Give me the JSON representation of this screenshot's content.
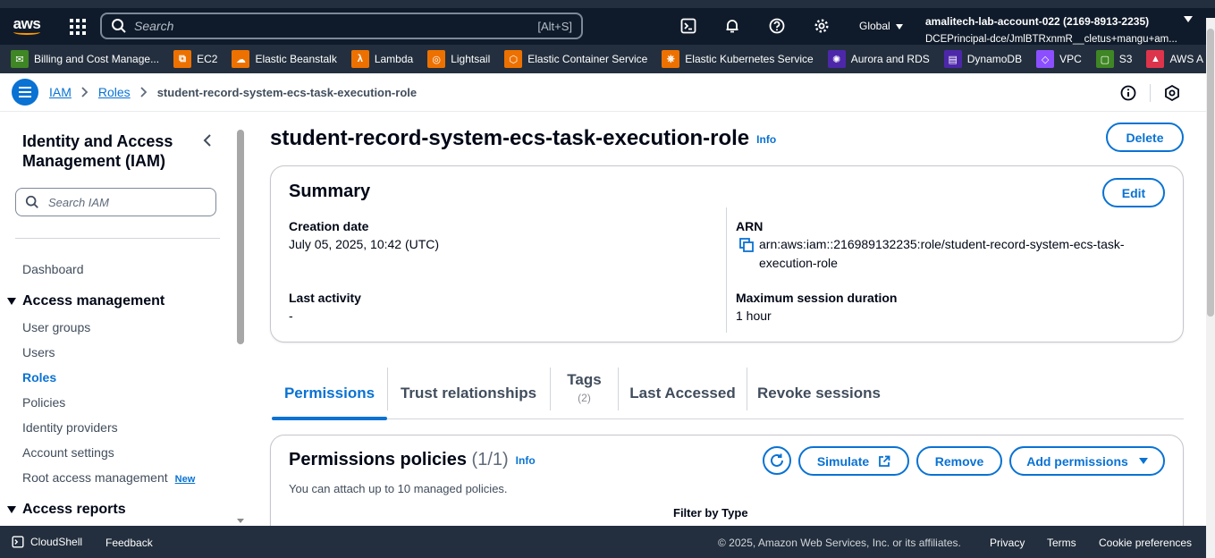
{
  "topnav": {
    "logo": "aws",
    "search_placeholder": "Search",
    "search_shortcut": "[Alt+S]",
    "region": "Global",
    "account_name": "amalitech-lab-account-022 (2169-8913-2235)",
    "account_principal": "DCEPrincipal-dce/JmlBTRxnmR__cletus+mangu+am..."
  },
  "favorites": [
    {
      "label": "Billing and Cost Manage...",
      "color": "#3f8624",
      "glyph": "✉"
    },
    {
      "label": "EC2",
      "color": "#ed7100",
      "glyph": "⧉"
    },
    {
      "label": "Elastic Beanstalk",
      "color": "#ed7100",
      "glyph": "☁"
    },
    {
      "label": "Lambda",
      "color": "#ed7100",
      "glyph": "λ"
    },
    {
      "label": "Lightsail",
      "color": "#ed7100",
      "glyph": "◎"
    },
    {
      "label": "Elastic Container Service",
      "color": "#ed7100",
      "glyph": "⬡"
    },
    {
      "label": "Elastic Kubernetes Service",
      "color": "#ed7100",
      "glyph": "⎈"
    },
    {
      "label": "Aurora and RDS",
      "color": "#4d27aa",
      "glyph": "✺"
    },
    {
      "label": "DynamoDB",
      "color": "#4d27aa",
      "glyph": "▤"
    },
    {
      "label": "VPC",
      "color": "#8c4fff",
      "glyph": "◇"
    },
    {
      "label": "S3",
      "color": "#3f8624",
      "glyph": "▢"
    },
    {
      "label": "AWS A",
      "color": "#dd344c",
      "glyph": "▲"
    }
  ],
  "breadcrumb": {
    "iam": "IAM",
    "roles": "Roles",
    "current": "student-record-system-ecs-task-execution-role"
  },
  "sidebar": {
    "title": "Identity and Access Management (IAM)",
    "search_placeholder": "Search IAM",
    "dashboard": "Dashboard",
    "access_management": "Access management",
    "items": [
      "User groups",
      "Users",
      "Roles",
      "Policies",
      "Identity providers",
      "Account settings",
      "Root access management"
    ],
    "new_badge": "New",
    "access_reports": "Access reports"
  },
  "main": {
    "title": "student-record-system-ecs-task-execution-role",
    "info": "Info",
    "delete": "Delete",
    "summary": {
      "title": "Summary",
      "edit": "Edit",
      "creation_date_label": "Creation date",
      "creation_date": "July 05, 2025, 10:42 (UTC)",
      "arn_label": "ARN",
      "arn_line1": "arn:aws:iam::216989132235:role/student-record-system-ecs-task-",
      "arn_line2": "execution-role",
      "last_activity_label": "Last activity",
      "last_activity": "-",
      "max_session_label": "Maximum session duration",
      "max_session": "1 hour"
    },
    "tabs": {
      "permissions": "Permissions",
      "trust": "Trust relationships",
      "tags": "Tags",
      "tags_count": "(2)",
      "last_accessed": "Last Accessed",
      "revoke": "Revoke sessions"
    },
    "permissions": {
      "title": "Permissions policies",
      "count": "(1/1)",
      "info": "Info",
      "subtitle": "You can attach up to 10 managed policies.",
      "simulate": "Simulate",
      "remove": "Remove",
      "add": "Add permissions",
      "filter_label": "Filter by Type"
    }
  },
  "footer": {
    "cloudshell": "CloudShell",
    "feedback": "Feedback",
    "copyright": "© 2025, Amazon Web Services, Inc. or its affiliates.",
    "privacy": "Privacy",
    "terms": "Terms",
    "cookies": "Cookie preferences"
  }
}
